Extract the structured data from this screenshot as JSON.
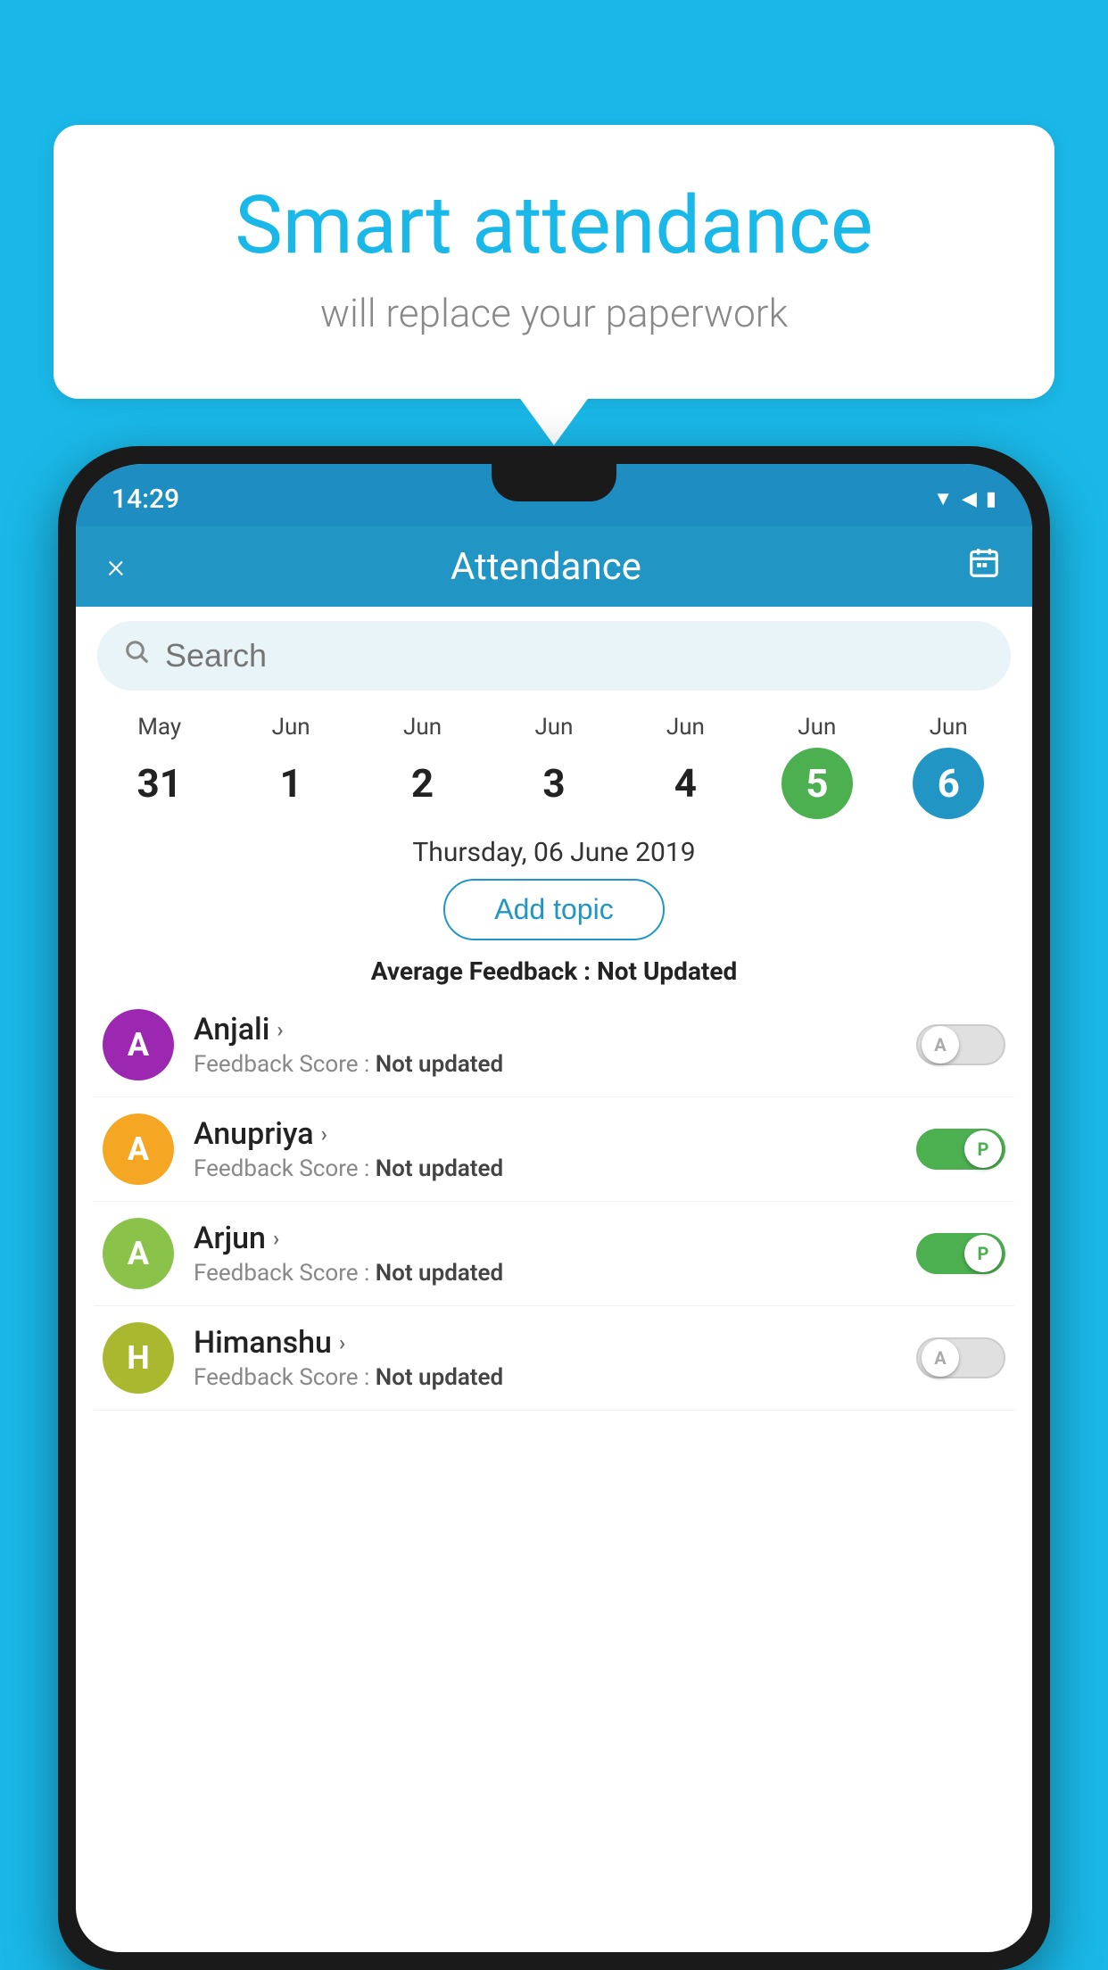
{
  "background": {
    "color": "#1ab8e8"
  },
  "speech_bubble": {
    "title": "Smart attendance",
    "subtitle": "will replace your paperwork"
  },
  "status_bar": {
    "time": "14:29"
  },
  "header": {
    "title": "Attendance",
    "close_label": "×",
    "calendar_icon": "📅"
  },
  "search": {
    "placeholder": "Search"
  },
  "calendar": {
    "days": [
      {
        "month": "May",
        "date": "31",
        "state": "normal"
      },
      {
        "month": "Jun",
        "date": "1",
        "state": "normal"
      },
      {
        "month": "Jun",
        "date": "2",
        "state": "normal"
      },
      {
        "month": "Jun",
        "date": "3",
        "state": "normal"
      },
      {
        "month": "Jun",
        "date": "4",
        "state": "normal"
      },
      {
        "month": "Jun",
        "date": "5",
        "state": "today"
      },
      {
        "month": "Jun",
        "date": "6",
        "state": "selected"
      }
    ]
  },
  "selected_date_label": "Thursday, 06 June 2019",
  "add_topic_btn": "Add topic",
  "average_feedback": {
    "label": "Average Feedback : ",
    "value": "Not Updated"
  },
  "students": [
    {
      "name": "Anjali",
      "avatar_letter": "A",
      "avatar_color": "#9c27b0",
      "score_label": "Feedback Score : ",
      "score_value": "Not updated",
      "attendance": "absent"
    },
    {
      "name": "Anupriya",
      "avatar_letter": "A",
      "avatar_color": "#f5a623",
      "score_label": "Feedback Score : ",
      "score_value": "Not updated",
      "attendance": "present"
    },
    {
      "name": "Arjun",
      "avatar_letter": "A",
      "avatar_color": "#8bc34a",
      "score_label": "Feedback Score : ",
      "score_value": "Not updated",
      "attendance": "present"
    },
    {
      "name": "Himanshu",
      "avatar_letter": "H",
      "avatar_color": "#aab830",
      "score_label": "Feedback Score : ",
      "score_value": "Not updated",
      "attendance": "absent"
    }
  ]
}
